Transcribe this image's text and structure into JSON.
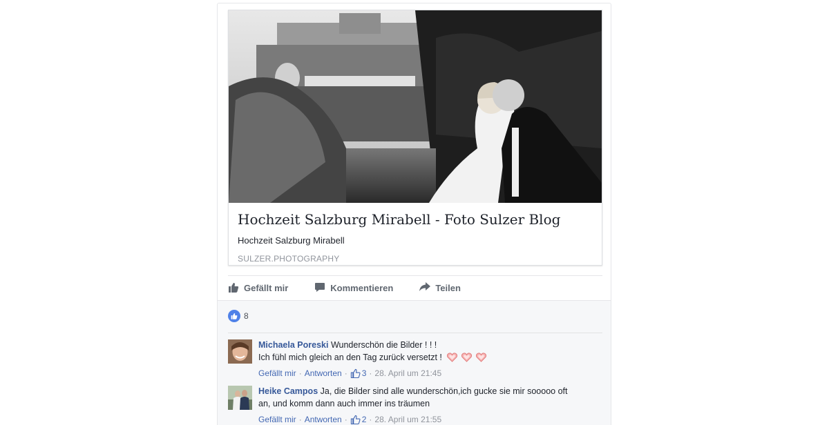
{
  "link_card": {
    "title": "Hochzeit Salzburg Mirabell - Foto Sulzer Blog",
    "description": "Hochzeit Salzburg Mirabell",
    "domain": "SULZER.PHOTOGRAPHY"
  },
  "actions": {
    "like": "Gefällt mir",
    "comment": "Kommentieren",
    "share": "Teilen"
  },
  "reactions": {
    "count": "8"
  },
  "comments": [
    {
      "author": "Michaela Poreski",
      "text_line1": "Wunderschön die Bilder ! ! !",
      "text_line2": "Ich fühl mich gleich an den Tag zurück versetzt !",
      "like_label": "Gefällt mir",
      "reply_label": "Antworten",
      "like_count": "3",
      "timestamp": "28. April um 21:45"
    },
    {
      "author": "Heike Campos",
      "text_line1": "Ja, die Bilder sind alle wunderschön,ich gucke sie mir sooooo oft",
      "text_line2": "an, und komm dann auch immer ins träumen",
      "like_label": "Gefällt mir",
      "reply_label": "Antworten",
      "like_count": "2",
      "timestamp": "28. April um 21:55"
    }
  ],
  "colors": {
    "link_blue": "#365899",
    "meta_blue": "#4267b2",
    "muted_gray": "#90949c",
    "reaction_blue": "#4f81e8",
    "heart": "#f08a8a"
  }
}
